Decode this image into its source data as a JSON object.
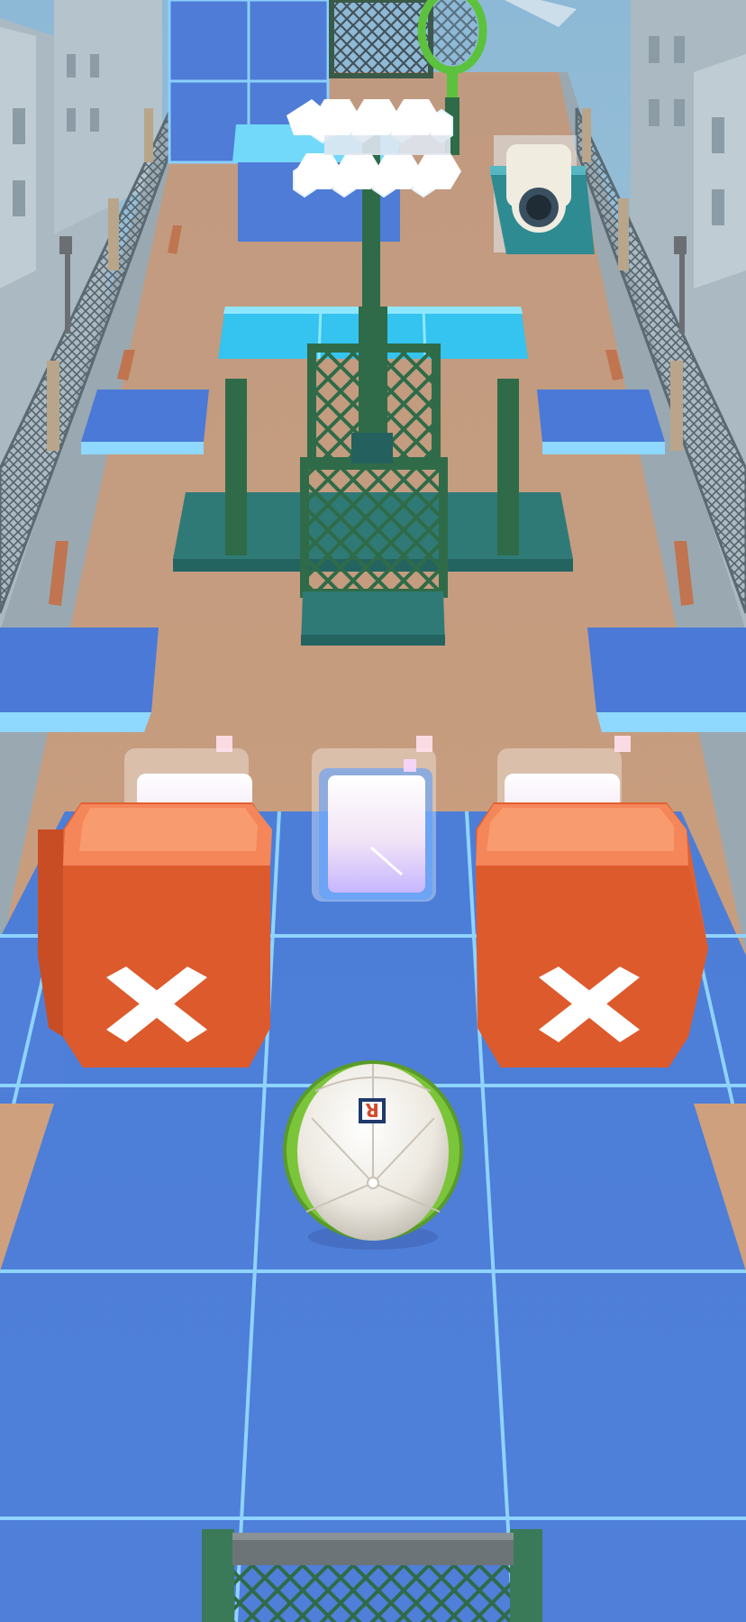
{
  "game": {
    "ball_badge": "R"
  },
  "colors": {
    "sky": "#9dc3db",
    "building": "#b7c8d2",
    "building_shadow": "#8fa7b5",
    "floor": "#c9a081",
    "tile": "#4f7fd6",
    "tile_line": "#8fd0ff",
    "ice": "#3fc7f2",
    "ice_top": "#7de0fb",
    "blue_pad": "#4a79d8",
    "blue_pad_top": "#6d95e6",
    "teal": "#2f7a76",
    "teal_dark": "#24605d",
    "green_frame": "#2f6b48",
    "crate": "#e8663a",
    "crate_top": "#f79a6a",
    "ball": "#ece8df",
    "ball_green": "#7bc53a",
    "racket": "#5cc23d",
    "lamp": "#ffffff"
  },
  "icons": {
    "obstacle_mark": "x-icon",
    "ball": "soccer-ball-icon",
    "lamp": "floodlight-icon",
    "racket": "tennis-racket-icon",
    "cannon": "cannon-icon"
  }
}
